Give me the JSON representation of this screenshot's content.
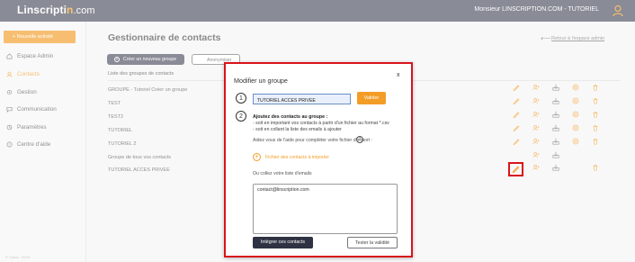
{
  "header": {
    "logo_part1": "Linscripti",
    "logo_part2": "n",
    "logo_part3": ".com",
    "user": "Monsieur LINSCRIPTION.COM - TUTORIEL"
  },
  "sidebar": {
    "new_activity": "+ Nouvelle activité",
    "items": [
      {
        "label": "Espace Admin",
        "icon": "home-icon"
      },
      {
        "label": "Contacts",
        "icon": "contacts-icon"
      },
      {
        "label": "Gestion",
        "icon": "gear-icon"
      },
      {
        "label": "Communication",
        "icon": "message-icon"
      },
      {
        "label": "Paramètres",
        "icon": "settings-icon"
      },
      {
        "label": "Centre d'aide",
        "icon": "help-icon"
      }
    ],
    "active_index": 1,
    "footer": "© Cyrus · 2024"
  },
  "main": {
    "title": "Gestionnaire de contacts",
    "back_link": "Retour à l'espace admin",
    "create_button": "Créer un nouveau groupe",
    "anon_button": "Anonymiser",
    "list_header": "Liste des groupes de contacts",
    "groups": [
      "GROUPE - Tutoriel Créer un groupe",
      "TEST",
      "TEST2",
      "TUTORIEL",
      "TUTORIEL 2",
      "Groupe de tous vos contacts",
      "TUTORIEL ACCES PRIVEE"
    ]
  },
  "modal": {
    "title": "Modifier un groupe",
    "close": "x",
    "step1": "1",
    "step2": "2",
    "group_name": "TUTORIEL ACCES PRIVEE",
    "validate": "Valider",
    "add_title": "Ajoutez des contacts au groupe :",
    "add_line1": "- soit en important vos contacts à partir d'un fichier au format *.csv",
    "add_line2": "- soit en collant la liste des emails à ajouter",
    "help_text": "Aidez vous de l'aide pour compléter votre fichier d'import :",
    "help_symbol": "?",
    "import_link": "Fichier des contacts à importer",
    "paste_label": "Ou collez votre liste d'emails",
    "emails_value": "contact@linscription.com",
    "integrate_button": "Intégrer ces contacts",
    "test_button": "Tester la validité"
  },
  "colors": {
    "accent": "#f39c26",
    "topbar": "#4a4d5e",
    "highlight": "#d9141b"
  }
}
